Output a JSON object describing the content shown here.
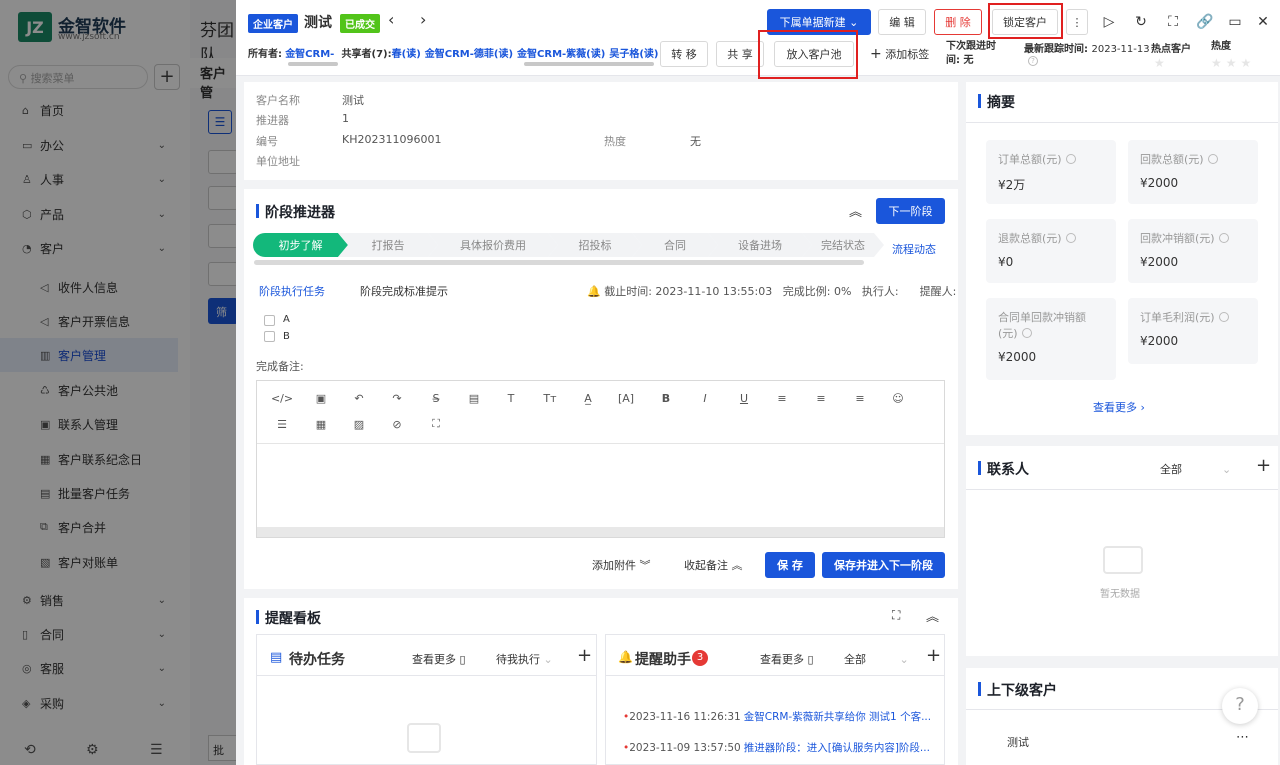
{
  "bg": {
    "logo_mark": "JZ",
    "logo_title": "金智软件",
    "logo_url": "www.jzsoft.cn",
    "search_placeholder": "搜索菜单",
    "company": "芬团队",
    "page_title": "客户管",
    "filter_btn": "筛",
    "nav": [
      {
        "label": "首页",
        "icon": "home-icon"
      },
      {
        "label": "办公",
        "icon": "office-icon"
      },
      {
        "label": "人事",
        "icon": "hr-icon"
      },
      {
        "label": "产品",
        "icon": "product-icon"
      },
      {
        "label": "客户",
        "icon": "customer-icon"
      },
      {
        "label": "收件人信息",
        "icon": "sound-icon"
      },
      {
        "label": "客户开票信息",
        "icon": "sound-icon"
      },
      {
        "label": "客户管理",
        "icon": "chart-icon"
      },
      {
        "label": "客户公共池",
        "icon": "pool-icon"
      },
      {
        "label": "联系人管理",
        "icon": "contact-icon"
      },
      {
        "label": "客户联系纪念日",
        "icon": "calendar-icon"
      },
      {
        "label": "批量客户任务",
        "icon": "task-icon"
      },
      {
        "label": "客户合并",
        "icon": "merge-icon"
      },
      {
        "label": "客户对账单",
        "icon": "bill-icon"
      },
      {
        "label": "销售",
        "icon": "sales-icon"
      },
      {
        "label": "合同",
        "icon": "contract-icon"
      },
      {
        "label": "客服",
        "icon": "service-icon"
      },
      {
        "label": "采购",
        "icon": "purchase-icon"
      }
    ],
    "bottom_btn": "批"
  },
  "header": {
    "tag_enterprise": "企业客户",
    "title": "测试",
    "tag_deal": "已成交",
    "new_sub_doc": "下属单据新建",
    "edit": "编 辑",
    "delete": "删 除",
    "lock": "锁定客户",
    "owner_label": "所有者:",
    "owner_value": "金智CRM-",
    "sharer_label": "共享者(7):",
    "sharers": [
      "春(读)",
      "金智CRM-德菲(读)",
      "金智CRM-紫薇(读)",
      "吴子格(读)"
    ],
    "transfer": "转 移",
    "share": "共 享",
    "put_pool": "放入客户池",
    "add_tag": "添加标签",
    "next_follow_label": "下次跟进时间:",
    "next_follow_value": "无",
    "last_follow_label": "最新跟踪时间:",
    "last_follow_value": "2023-11-13",
    "hot_label": "热点客户",
    "heat_label": "热度"
  },
  "basic": {
    "name_label": "客户名称",
    "name_value": "测试",
    "promoter_label": "推进器",
    "promoter_value": "1",
    "code_label": "编号",
    "code_value": "KH202311096001",
    "heat_label": "热度",
    "heat_value": "无",
    "address_label": "单位地址"
  },
  "stage": {
    "title": "阶段推进器",
    "next": "下一阶段",
    "dynamic": "流程动态",
    "stages": [
      "初步了解",
      "打报告",
      "具体报价费用",
      "招投标",
      "合同",
      "设备进场",
      "完结状态"
    ],
    "task_tab": "阶段执行任务",
    "hint_tab": "阶段完成标准提示",
    "deadline_label": "截止时间:",
    "deadline_value": "2023-11-10 13:55:03",
    "ratio_label": "完成比例:",
    "ratio_value": "0%",
    "executor_label": "执行人:",
    "reminder_label": "提醒人:",
    "checks": [
      "A",
      "B"
    ],
    "note_label": "完成备注:",
    "attach": "添加附件",
    "collapse_note": "收起备注",
    "save": "保 存",
    "save_next": "保存并进入下一阶段"
  },
  "remind": {
    "title": "提醒看板",
    "todo_title": "待办任务",
    "more": "查看更多",
    "pending": "待我执行",
    "assistant_title": "提醒助手",
    "badge": "3",
    "all": "全部",
    "msgs": [
      {
        "time": "2023-11-16 11:26:31",
        "text": "金智CRM-紫薇新共享给你 测试1 个客..."
      },
      {
        "time": "2023-11-09 13:57:50",
        "text": "推进器阶段：进入[确认服务内容]阶段..."
      }
    ]
  },
  "summary": {
    "title": "摘要",
    "items": [
      {
        "label": "订单总额(元)",
        "value": "¥2万"
      },
      {
        "label": "回款总额(元)",
        "value": "¥2000"
      },
      {
        "label": "退款总额(元)",
        "value": "¥0"
      },
      {
        "label": "回款冲销额(元)",
        "value": "¥2000"
      },
      {
        "label": "合同单回款冲销额(元)",
        "value": "¥2000"
      },
      {
        "label": "订单毛利润(元)",
        "value": "¥2000"
      }
    ],
    "more": "查看更多"
  },
  "contacts": {
    "title": "联系人",
    "filter": "全部",
    "empty": "暂无数据"
  },
  "related": {
    "title": "上下级客户",
    "item": "测试"
  },
  "colors": {
    "primary": "#1a56db",
    "green": "#13b87b",
    "danger": "#e53935",
    "highlight": "#e02020"
  }
}
